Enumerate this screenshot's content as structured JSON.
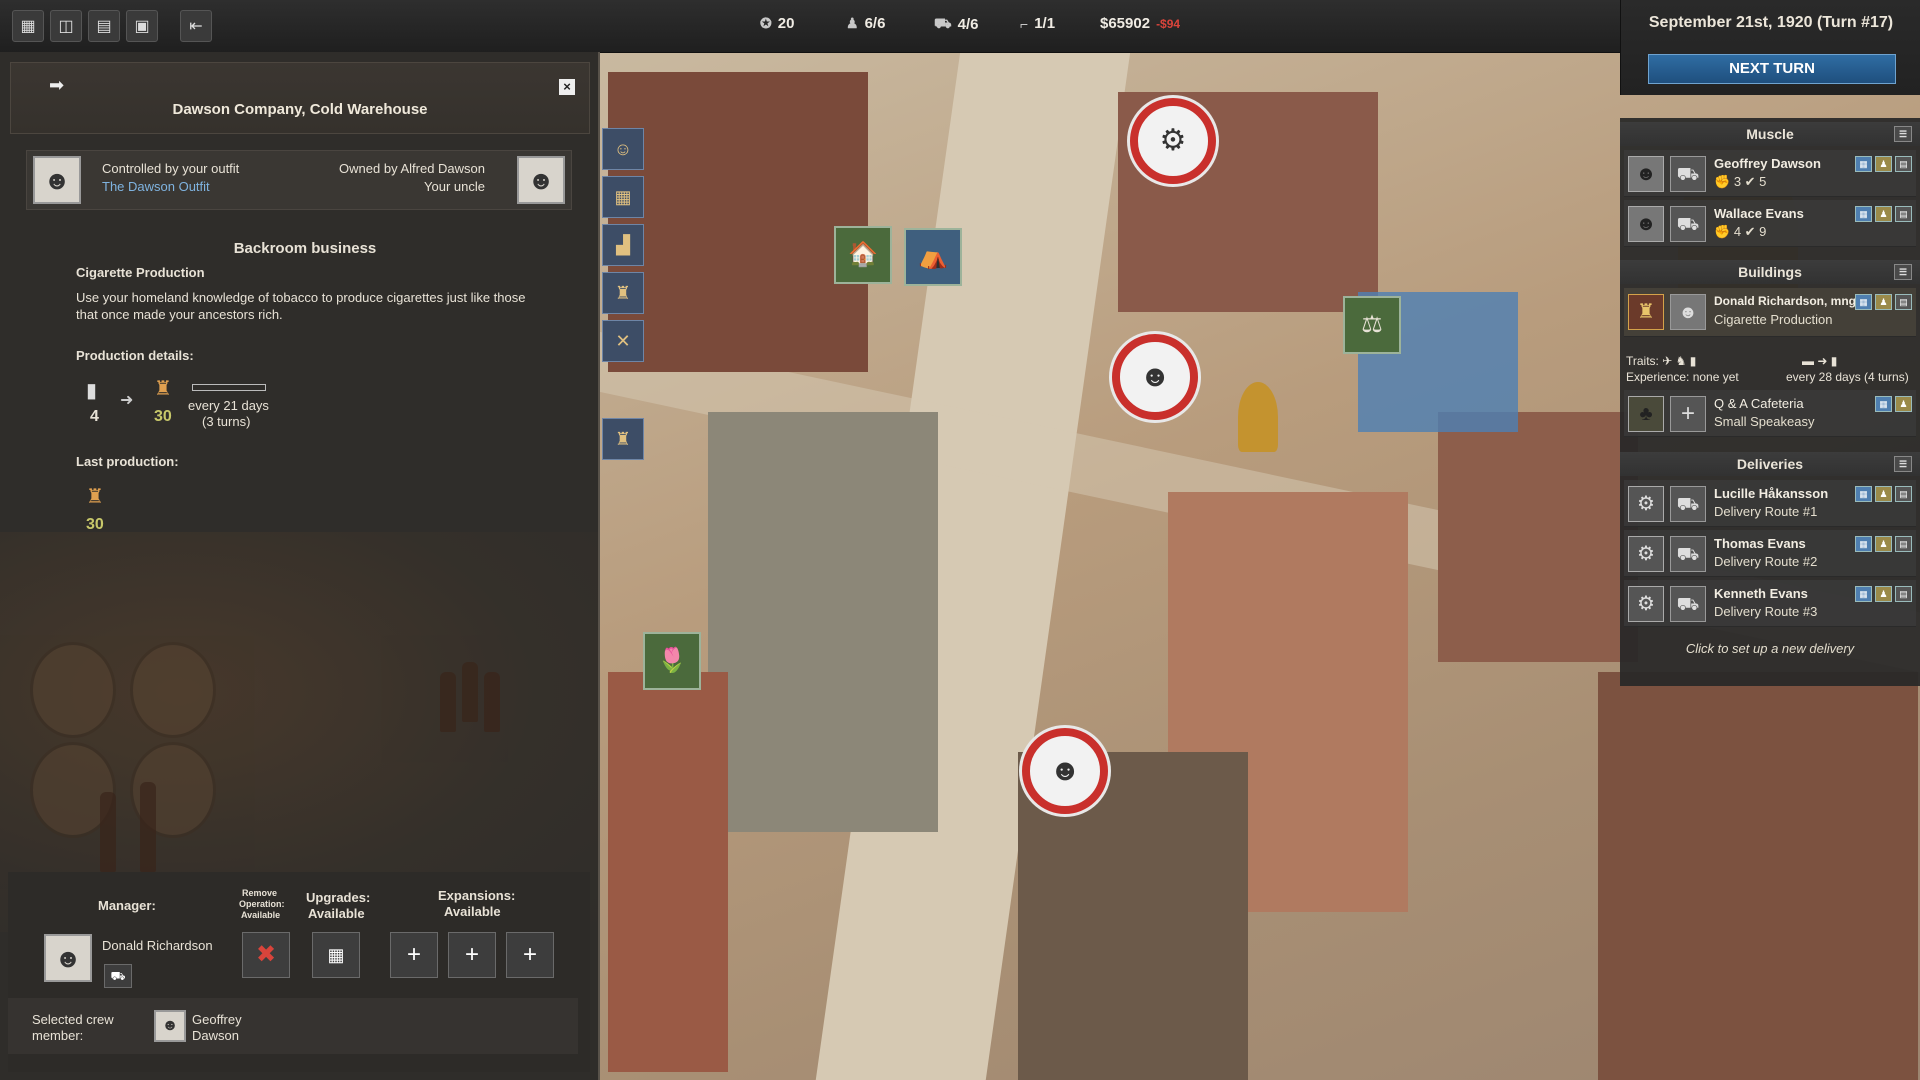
{
  "topbar": {
    "stats": [
      {
        "icon": "ammo-icon",
        "value": "20"
      },
      {
        "icon": "crew-icon",
        "value": "6/6"
      },
      {
        "icon": "truck-icon",
        "value": "4/6"
      },
      {
        "icon": "gun-icon",
        "value": "1/1"
      }
    ],
    "money": "$65902",
    "money_delta": "-$94"
  },
  "turn": {
    "date": "September 21st, 1920 (Turn #17)",
    "next_turn_label": "NEXT TURN"
  },
  "right_panel": {
    "muscle": {
      "header": "Muscle",
      "rows": [
        {
          "name": "Geoffrey Dawson",
          "stats": "3 ✔ 5"
        },
        {
          "name": "Wallace Evans",
          "stats": "4 ✔ 9"
        }
      ]
    },
    "buildings": {
      "header": "Buildings",
      "manager": "Donald Richardson, mng",
      "operation": "Cigarette Production",
      "traits_label": "Traits:",
      "experience": "Experience: none yet",
      "cycle": "every 28 days (4 turns)",
      "extra": {
        "name": "Q & A Cafeteria",
        "type": "Small Speakeasy"
      }
    },
    "deliveries": {
      "header": "Deliveries",
      "rows": [
        {
          "name": "Lucille Håkansson",
          "route": "Delivery Route #1"
        },
        {
          "name": "Thomas Evans",
          "route": "Delivery Route #2"
        },
        {
          "name": "Kenneth Evans",
          "route": "Delivery Route #3"
        }
      ],
      "new_label": "Click to set up a new delivery"
    }
  },
  "left_panel": {
    "title": "Dawson Company, Cold Warehouse",
    "controlled_label": "Controlled by your outfit",
    "outfit": "The Dawson Outfit",
    "owned_label": "Owned by Alfred Dawson",
    "relation": "Your uncle",
    "section": "Backroom business",
    "operation": "Cigarette Production",
    "description": "Use your homeland knowledge of tobacco to produce cigarettes just like those that once made your ancestors rich.",
    "production_label": "Production details:",
    "input_qty": "4",
    "output_qty": "30",
    "cycle_line1": "every 21 days",
    "cycle_line2": "(3 turns)",
    "last_label": "Last production:",
    "last_qty": "30",
    "manager_label": "Manager:",
    "manager_name": "Donald Richardson",
    "remove_label_1": "Remove",
    "remove_label_2": "Operation:",
    "remove_label_3": "Available",
    "upgrades_label": "Upgrades:",
    "upgrades_status": "Available",
    "expansions_label": "Expansions:",
    "expansions_status": "Available",
    "crew_label_1": "Selected crew",
    "crew_label_2": "member:",
    "crew_name_1": "Geoffrey",
    "crew_name_2": "Dawson"
  },
  "colors": {
    "accent_blue": "#2f6da3",
    "alert_red": "#d9443b",
    "marker_red": "#c9302c"
  }
}
